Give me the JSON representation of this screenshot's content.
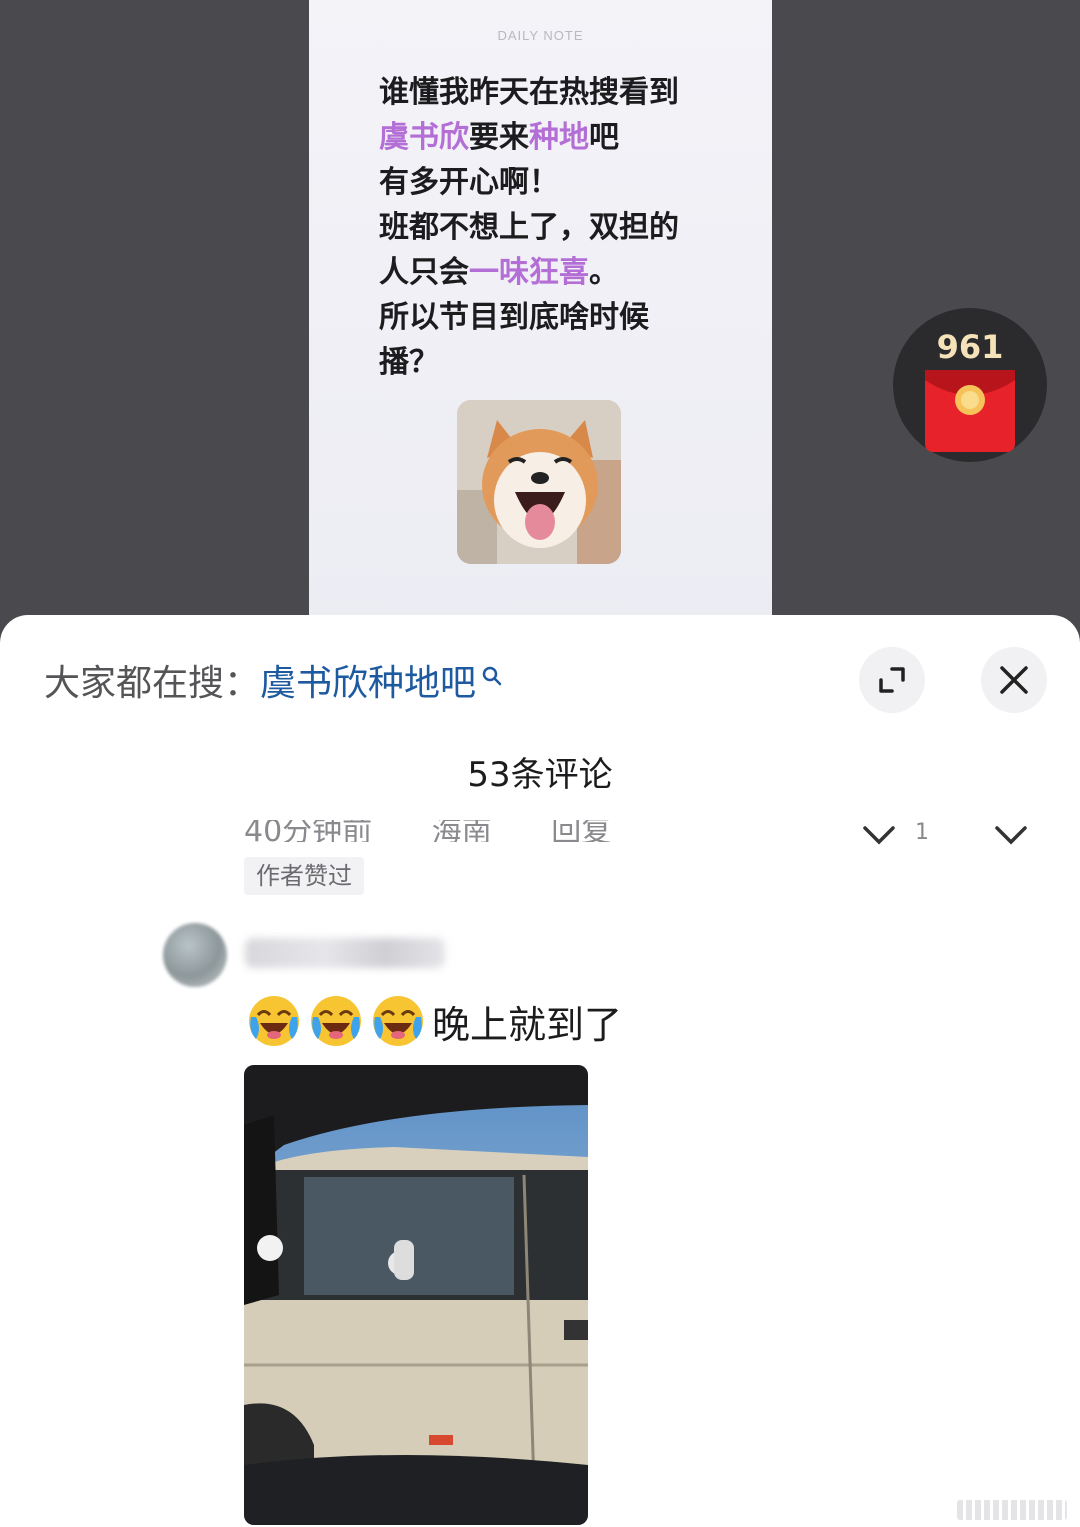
{
  "post": {
    "header": "DAILY NOTE",
    "lines": [
      [
        {
          "t": "谁懂我昨天在热搜看到",
          "h": false
        }
      ],
      [
        {
          "t": "虞书欣",
          "h": true
        },
        {
          "t": "要来",
          "h": false
        },
        {
          "t": "种地",
          "h": true
        },
        {
          "t": "吧",
          "h": false
        }
      ],
      [
        {
          "t": "有多开心啊！",
          "h": false
        }
      ],
      [
        {
          "t": "班都不想上了，双担的",
          "h": false
        }
      ],
      [
        {
          "t": "人只会",
          "h": false
        },
        {
          "t": "一味狂喜",
          "h": true
        },
        {
          "t": "。",
          "h": false
        }
      ],
      [
        {
          "t": "所以节目到底啥时候",
          "h": false
        }
      ],
      [
        {
          "t": "播？",
          "h": false
        }
      ]
    ],
    "image": "shiba-dog-laughing"
  },
  "red_packet": {
    "count": "961",
    "icon": "red-envelope-icon"
  },
  "sheet": {
    "search_prefix": "大家都在搜：",
    "search_term": "虞书欣种地吧",
    "comment_count": "53条评论",
    "prev_comment": {
      "meta": [
        "40分钟前",
        "海南",
        "回复"
      ],
      "like_count": "1",
      "badge": "作者赞过"
    },
    "reply": {
      "emojis": [
        "crying-laughing-emoji",
        "crying-laughing-emoji",
        "crying-laughing-emoji"
      ],
      "text": "晚上就到了",
      "photo": "van-through-car-window"
    }
  },
  "colors": {
    "highlight": "#b46fd6",
    "search_term": "#1e5aa0",
    "red_packet": "#e8222a"
  }
}
